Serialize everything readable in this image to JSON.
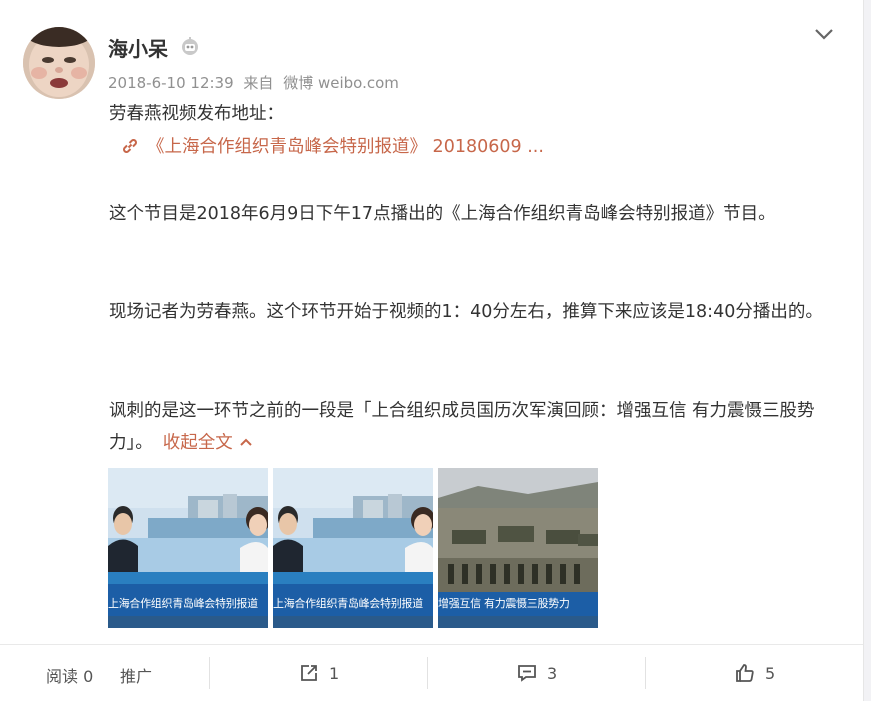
{
  "post": {
    "username": "海小呆",
    "date": "2018-6-10 12:39",
    "from": "来自",
    "source": "微博 weibo.com",
    "line1": "劳春燕视频发布地址：",
    "link_text": "《上海合作组织青岛峰会特别报道》 20180609 ...",
    "para1": "这个节目是2018年6月9日下午17点播出的《上海合作组织青岛峰会特别报道》节目。",
    "para2": "现场记者为劳春燕。这个环节开始于视频的1：40分左右，推算下来应该是18:40分播出的。",
    "para3": "讽刺的是这一环节之前的一段是「上合组织成员国历次军演回顾：增强互信 有力震慑三股势力」。",
    "collapse_label": "收起全文"
  },
  "thumbnails": [
    {
      "caption": "上海合作组织青岛峰会特别报道",
      "tag": "青岛 央视记者 劳春燕"
    },
    {
      "caption": "上海合作组织青岛峰会特别报道",
      "tag": "青岛 央视记者 劳春燕"
    },
    {
      "caption": "增强互信 有力震慑三股势力",
      "tag": ""
    }
  ],
  "footer": {
    "read_label": "阅读",
    "read_count": "0",
    "promote_label": "推广",
    "repost_count": "1",
    "comment_count": "3",
    "like_count": "5"
  },
  "colors": {
    "link": "#c7674a",
    "meta": "#909090"
  }
}
